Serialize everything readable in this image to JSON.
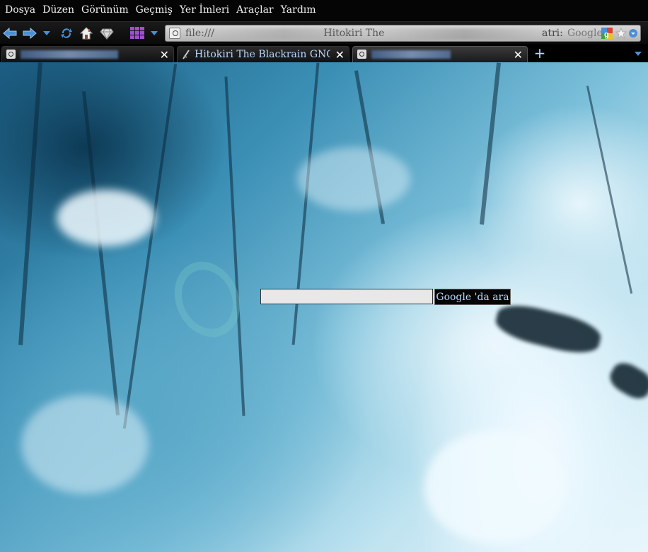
{
  "menu": [
    "Dosya",
    "Düzen",
    "Görünüm",
    "Geçmiş",
    "Yer İmleri",
    "Araçlar",
    "Yardım"
  ],
  "navbar": {
    "url_visible_fragment": "file:///",
    "url_partial_title": "Hitokiri The",
    "url_tail": "atri:",
    "search_engine_label": "Google"
  },
  "tabs": [
    {
      "label": "",
      "blurred": true,
      "active": false
    },
    {
      "label": "Hitokiri The Blackrain GNO…",
      "blurred": false,
      "active": false
    },
    {
      "label": "",
      "blurred": true,
      "active": true
    }
  ],
  "content": {
    "search_button_label": "Google 'da ara",
    "search_input_value": ""
  },
  "colors": {
    "chrome_bg": "#050505",
    "tab_text": "#b8d8ff",
    "icon_blue": "#4a8fd6",
    "icon_purple": "#a050d0"
  }
}
